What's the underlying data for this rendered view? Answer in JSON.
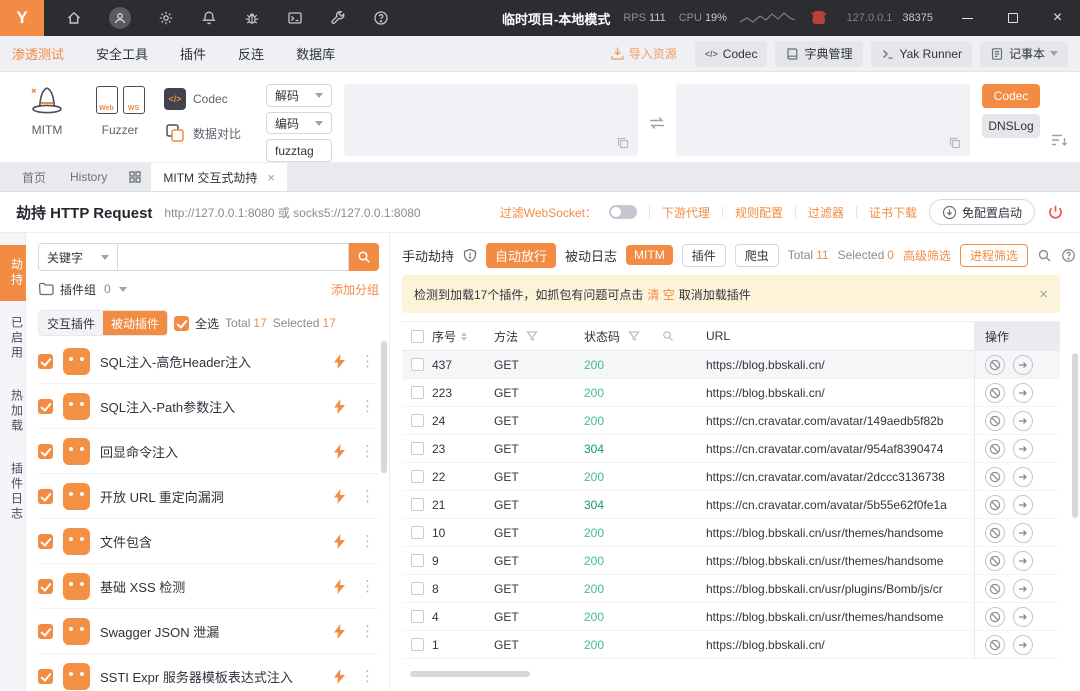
{
  "colors": {
    "accent": "#f28b44",
    "status_200": "#42bd8a",
    "status_304": "#0c9e72",
    "danger": "#f4544a"
  },
  "titlebar": {
    "title": "临时项目-本地模式",
    "rps_label": "RPS",
    "rps_value": "111",
    "cpu_label": "CPU",
    "cpu_value": "19%",
    "host": "127.0.0.1",
    "port": "38375"
  },
  "menubar": {
    "items": [
      {
        "label": "渗透测试"
      },
      {
        "label": "安全工具"
      },
      {
        "label": "插件"
      },
      {
        "label": "反连"
      },
      {
        "label": "数据库"
      }
    ],
    "import_label": "导入资源",
    "codec_label": "Codec",
    "dict_label": "字典管理",
    "yak_runner_label": "Yak Runner",
    "notepad_label": "记事本"
  },
  "toolbar": {
    "mitm_label": "MITM",
    "fuzzer_label": "Fuzzer",
    "web_tag": "Web",
    "ws_tag": "WS",
    "codec_label": "Codec",
    "compare_label": "数据对比",
    "decode_btn": "解码",
    "encode_btn": "编码",
    "fuzztag_btn": "fuzztag",
    "codec_run_btn": "Codec",
    "dnslog_btn": "DNSLog"
  },
  "tabstrip": {
    "home": "首页",
    "history": "History",
    "active_tab": "MITM 交互式劫持"
  },
  "hijack": {
    "title": "劫持 HTTP Request",
    "subtitle": "http://127.0.0.1:8080 或 socks5://127.0.0.1:8080",
    "ws_filter_label": "过滤WebSocket：",
    "links": [
      "下游代理",
      "规则配置",
      "过滤器",
      "证书下载"
    ],
    "quickstart_btn": "免配置启动"
  },
  "vtabs": [
    "劫持",
    "已启用",
    "热加载",
    "插件日志"
  ],
  "left_panel": {
    "keyword_label": "关键字",
    "group_label": "插件组",
    "group_count": "0",
    "add_group_link": "添加分组",
    "tab_interactive": "交互插件",
    "tab_passive": "被动插件",
    "select_all_label": "全选",
    "total_label": "Total",
    "total_value": "17",
    "selected_label": "Selected",
    "selected_value": "17",
    "plugins": [
      "SQL注入-高危Header注入",
      "SQL注入-Path参数注入",
      "回显命令注入",
      "开放 URL 重定向漏洞",
      "文件包含",
      "基础 XSS 检测",
      "Swagger JSON 泄漏",
      "SSTI Expr 服务器模板表达式注入"
    ]
  },
  "right_panel": {
    "tab_manual": "手动劫持",
    "tab_auto": "自动放行",
    "tab_passive_log": "被动日志",
    "mitm_badge": "MITM",
    "plugin_chip": "插件",
    "crawler_chip": "爬虫",
    "total_label": "Total",
    "total_value": "11",
    "selected_label": "Selected",
    "selected_value": "0",
    "advanced_filter_link": "高级筛选",
    "process_filter_btn": "进程筛选",
    "banner": {
      "text_pre": "检测到加载17个插件，如抓包有问题可点击",
      "clear_link": "清 空",
      "text_post": "取消加载插件"
    },
    "table": {
      "header_id": "序号",
      "header_method": "方法",
      "header_status": "状态码",
      "header_url": "URL",
      "header_ops": "操作",
      "rows": [
        {
          "id": "437",
          "method": "GET",
          "status": "200",
          "url": "https://blog.bbskali.cn/"
        },
        {
          "id": "223",
          "method": "GET",
          "status": "200",
          "url": "https://blog.bbskali.cn/"
        },
        {
          "id": "24",
          "method": "GET",
          "status": "200",
          "url": "https://cn.cravatar.com/avatar/149aedb5f82b"
        },
        {
          "id": "23",
          "method": "GET",
          "status": "304",
          "url": "https://cn.cravatar.com/avatar/954af8390474"
        },
        {
          "id": "22",
          "method": "GET",
          "status": "200",
          "url": "https://cn.cravatar.com/avatar/2dccc3136738"
        },
        {
          "id": "21",
          "method": "GET",
          "status": "304",
          "url": "https://cn.cravatar.com/avatar/5b55e62f0fe1a"
        },
        {
          "id": "10",
          "method": "GET",
          "status": "200",
          "url": "https://blog.bbskali.cn/usr/themes/handsome"
        },
        {
          "id": "9",
          "method": "GET",
          "status": "200",
          "url": "https://blog.bbskali.cn/usr/themes/handsome"
        },
        {
          "id": "8",
          "method": "GET",
          "status": "200",
          "url": "https://blog.bbskali.cn/usr/plugins/Bomb/js/cr"
        },
        {
          "id": "4",
          "method": "GET",
          "status": "200",
          "url": "https://blog.bbskali.cn/usr/themes/handsome"
        },
        {
          "id": "1",
          "method": "GET",
          "status": "200",
          "url": "https://blog.bbskali.cn/"
        }
      ]
    }
  }
}
